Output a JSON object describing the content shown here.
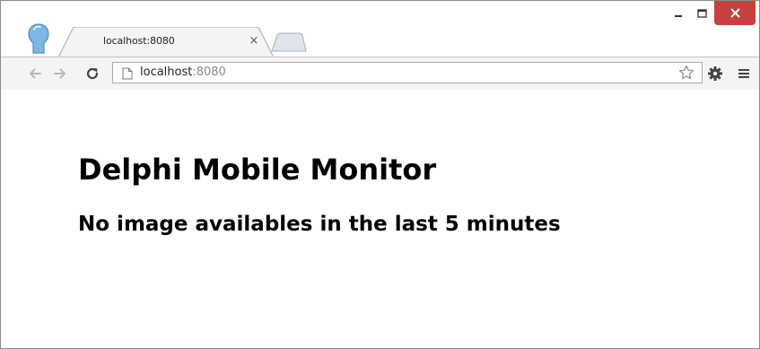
{
  "browser": {
    "tab": {
      "title": "localhost:8080",
      "close_glyph": "×"
    },
    "omnibox": {
      "url_host": "localhost",
      "url_port": ":8080"
    },
    "icons": {
      "profile": "profile-avatar-icon",
      "back": "arrow-left-icon",
      "forward": "arrow-right-icon",
      "reload": "reload-icon",
      "page": "page-icon",
      "bookmark": "star-icon",
      "settings": "gear-icon",
      "menu": "hamburger-menu-icon",
      "minimize": "minimize-icon",
      "maximize": "maximize-icon",
      "close": "close-icon"
    },
    "colors": {
      "close_button": "#c8403d",
      "toolbar": "#f4f4f4"
    }
  },
  "page": {
    "heading": "Delphi Mobile Monitor",
    "message": "No image availables in the last 5 minutes"
  }
}
